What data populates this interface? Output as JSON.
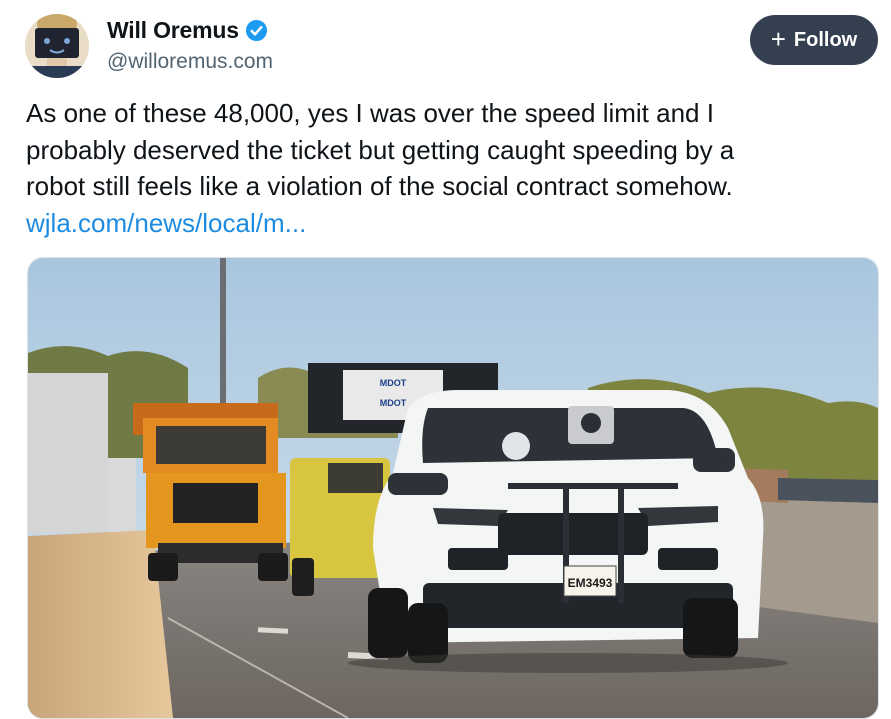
{
  "author": {
    "name": "Will Oremus",
    "handle": "@willoremus.com",
    "verified": true,
    "avatar_icon": "avatar-person-icon"
  },
  "follow_button": {
    "label": "Follow",
    "icon": "plus-icon"
  },
  "post": {
    "lines": [
      "As one of these 48,000, yes I was over the speed limit and I",
      "probably deserved the ticket but getting caught speeding by a",
      "robot still feels like a violation of the social contract somehow."
    ],
    "link_text": "wjla.com/news/local/m..."
  },
  "media": {
    "type": "photo",
    "plate_text": "EM3493",
    "sign_texts": [
      "MDOT",
      "MDOT"
    ]
  },
  "colors": {
    "link": "#1d8ce0",
    "verified_badge": "#1d9bf0",
    "follow_bg": "#34404f"
  }
}
